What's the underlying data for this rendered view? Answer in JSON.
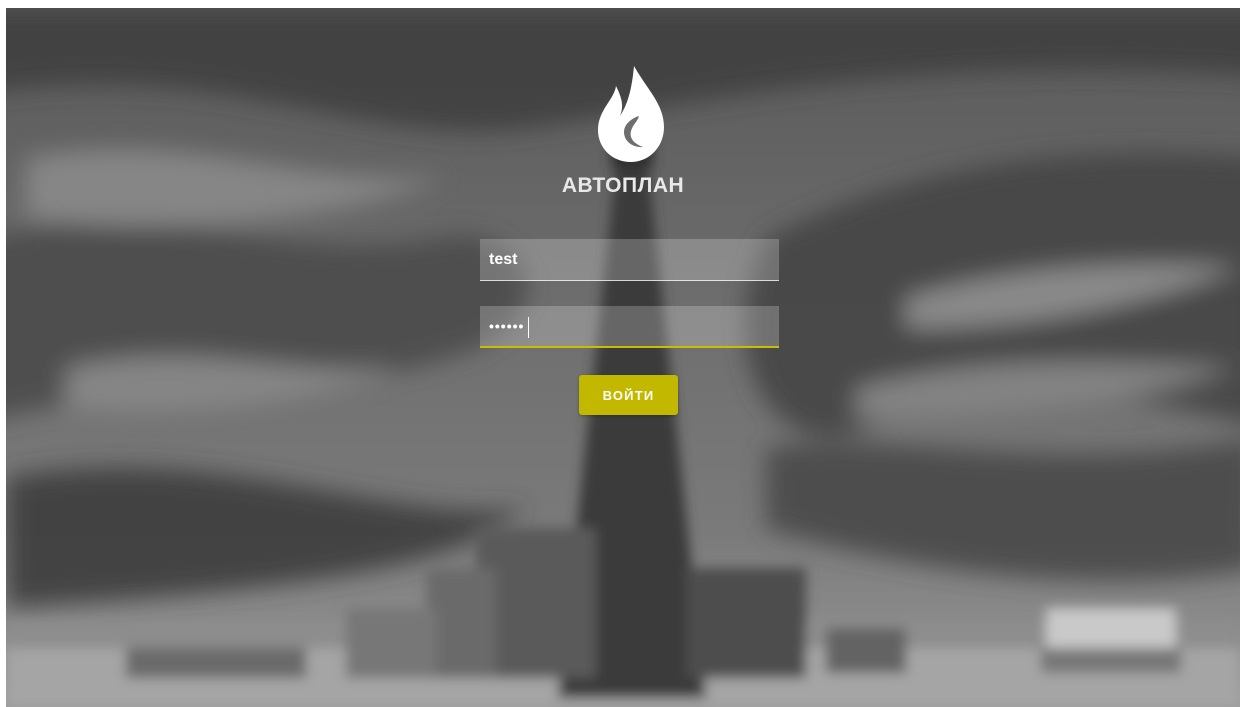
{
  "app": {
    "name": "АВТОПЛАН",
    "logo_icon": "flame-drop-icon"
  },
  "login": {
    "username_value": "test",
    "password_value": "••••••",
    "submit_label": "ВОЙТИ"
  },
  "colors": {
    "accent": "#c3b800",
    "text": "#ffffff",
    "background": "#6b6b6b"
  }
}
